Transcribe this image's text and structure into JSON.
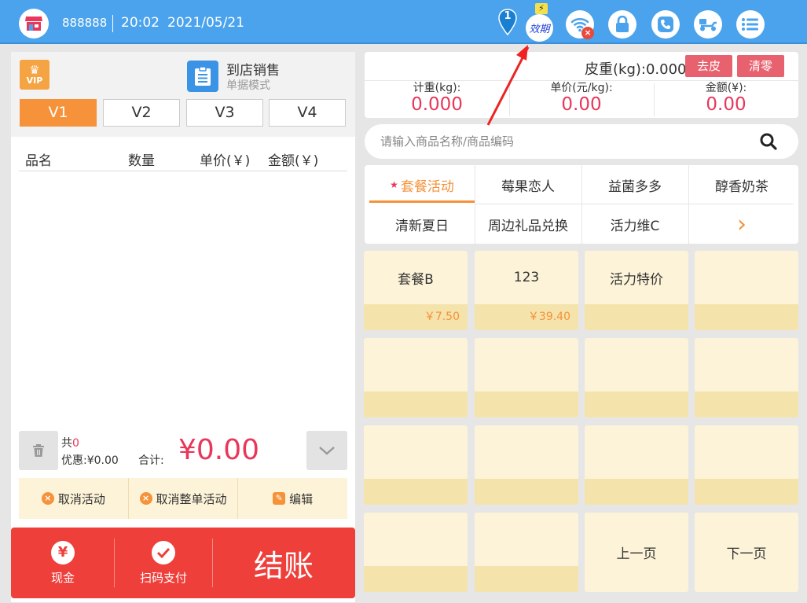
{
  "header": {
    "store_no": "888888",
    "time": "20:02",
    "date": "2021/05/21",
    "notification_count": "1",
    "validity_badge": "⚡",
    "validity_label": "效期",
    "icons": [
      "store-icon",
      "map-pin-icon",
      "validity-icon",
      "wifi-off-icon",
      "lock-icon",
      "phone-icon",
      "delivery-icon",
      "menu-list-icon"
    ],
    "bar_color": "#4aa3ec"
  },
  "left": {
    "vip_label": "VIP",
    "mode_title": "到店销售",
    "mode_subtitle": "单据模式",
    "tabs": [
      {
        "label": "V1",
        "active": true
      },
      {
        "label": "V2",
        "active": false
      },
      {
        "label": "V3",
        "active": false
      },
      {
        "label": "V4",
        "active": false
      }
    ],
    "columns": [
      "品名",
      "数量",
      "单价(￥)",
      "金额(￥)"
    ],
    "summary": {
      "count_prefix": "共",
      "count": "0",
      "discount_label": "优惠:",
      "discount_value": "¥0.00",
      "total_label": "合计:",
      "total_value": "¥0.00"
    },
    "actions": [
      "取消活动",
      "取消整单活动",
      "编辑"
    ],
    "payment": {
      "cash": "现金",
      "cash_glyph": "¥",
      "scan": "扫码支付",
      "checkout": "结账"
    }
  },
  "scale": {
    "tare": "皮重(kg):0.000",
    "tare_button": "去皮",
    "zero_button": "清零",
    "weight_label": "计重(kg):",
    "weight_value": "0.000",
    "unit_price_label": "单价(元/kg):",
    "unit_price_value": "0.00",
    "amount_label": "金额(¥):",
    "amount_value": "0.00"
  },
  "search": {
    "placeholder": "请输入商品名称/商品编码"
  },
  "categories": {
    "items": [
      "套餐活动",
      "莓果恋人",
      "益菌多多",
      "醇香奶茶",
      "清新夏日",
      "周边礼品兑换",
      "活力维C"
    ],
    "active": "套餐活动",
    "active_marker": "★",
    "more_glyph": "›"
  },
  "products": [
    {
      "name": "套餐B",
      "price": "￥7.50"
    },
    {
      "name": "123",
      "price": "￥39.40"
    },
    {
      "name": "活力特价",
      "price": ""
    }
  ],
  "pager": {
    "prev": "上一页",
    "next": "下一页"
  },
  "colors": {
    "accent_orange": "#f5923a",
    "price_red": "#e8375a",
    "checkout_red": "#ee3f3b",
    "tile_bg": "#fdf3d8",
    "tile_strip": "#f5e3ac"
  }
}
